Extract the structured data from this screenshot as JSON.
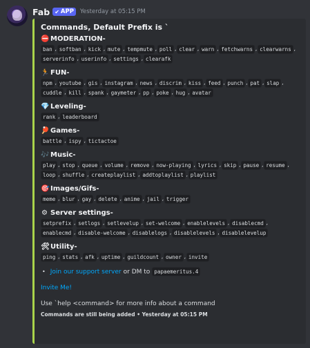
{
  "message": {
    "username": "Fab",
    "badge": "APP",
    "timestamp": "Yesterday at 05:15 PM"
  },
  "embed": {
    "title": "Commands, Default Prefix is `",
    "accent": "#a9d44a",
    "sections": [
      {
        "emoji": "⛔",
        "heading": "MODERATION-",
        "commands": [
          "ban",
          "softban",
          "kick",
          "mute",
          "tempmute",
          "poll",
          "clear",
          "warn",
          "fetchwarns",
          "clearwarns",
          "serverinfo",
          "userinfo",
          "settings",
          "clearafk"
        ]
      },
      {
        "emoji": "🏃",
        "heading": "FUN-",
        "commands": [
          "npm",
          "youtube",
          "gis",
          "instagram",
          "news",
          "discrim",
          "kiss",
          "feed",
          "punch",
          "pat",
          "slap",
          "cuddle",
          "kill",
          "spank",
          "gaymeter",
          "pp",
          "poke",
          "hug",
          "avatar"
        ]
      },
      {
        "emoji": "💎",
        "heading": "Leveling-",
        "commands": [
          "rank",
          "leaderboard"
        ]
      },
      {
        "emoji": "🏓",
        "heading": "Games-",
        "commands": [
          "battle",
          "ispy",
          "tictactoe"
        ]
      },
      {
        "emoji": "🎶",
        "heading": "Music-",
        "commands": [
          "play",
          "stop",
          "queue",
          "volume",
          "remove",
          "now-playing",
          "lyrics",
          "skip",
          "pause",
          "resume",
          "loop",
          "shuffle",
          "createplaylist",
          "addtoplaylist",
          "playlist"
        ]
      },
      {
        "emoji": "🎯",
        "heading": "Images/Gifs-",
        "commands": [
          "meme",
          "blur",
          "gay",
          "delete",
          "anime",
          "jail",
          "trigger"
        ]
      },
      {
        "emoji": "⚙",
        "heading": "Server settings-",
        "commands": [
          "setprefix",
          "setlogs",
          "setlevelup",
          "set-welcome",
          "enablelevels",
          "disablecmd",
          "enablecmd",
          "disable-welcome",
          "disablelogs",
          "disablelevels",
          "disablelevelup"
        ]
      },
      {
        "emoji": "🛠",
        "heading": "Utility-",
        "commands": [
          "ping",
          "stats",
          "afk",
          "uptime",
          "guildcount",
          "owner",
          "invite"
        ]
      }
    ],
    "support": {
      "link_text": "Join our support server",
      "or_text": "or DM to",
      "handle": "papaemeritus.4"
    },
    "invite_text": "Invite Me!",
    "help_text": "Use `help <command> for more info about a command",
    "footer_text": "Commands are still being added",
    "footer_time": "Yesterday at 05:15 PM"
  }
}
